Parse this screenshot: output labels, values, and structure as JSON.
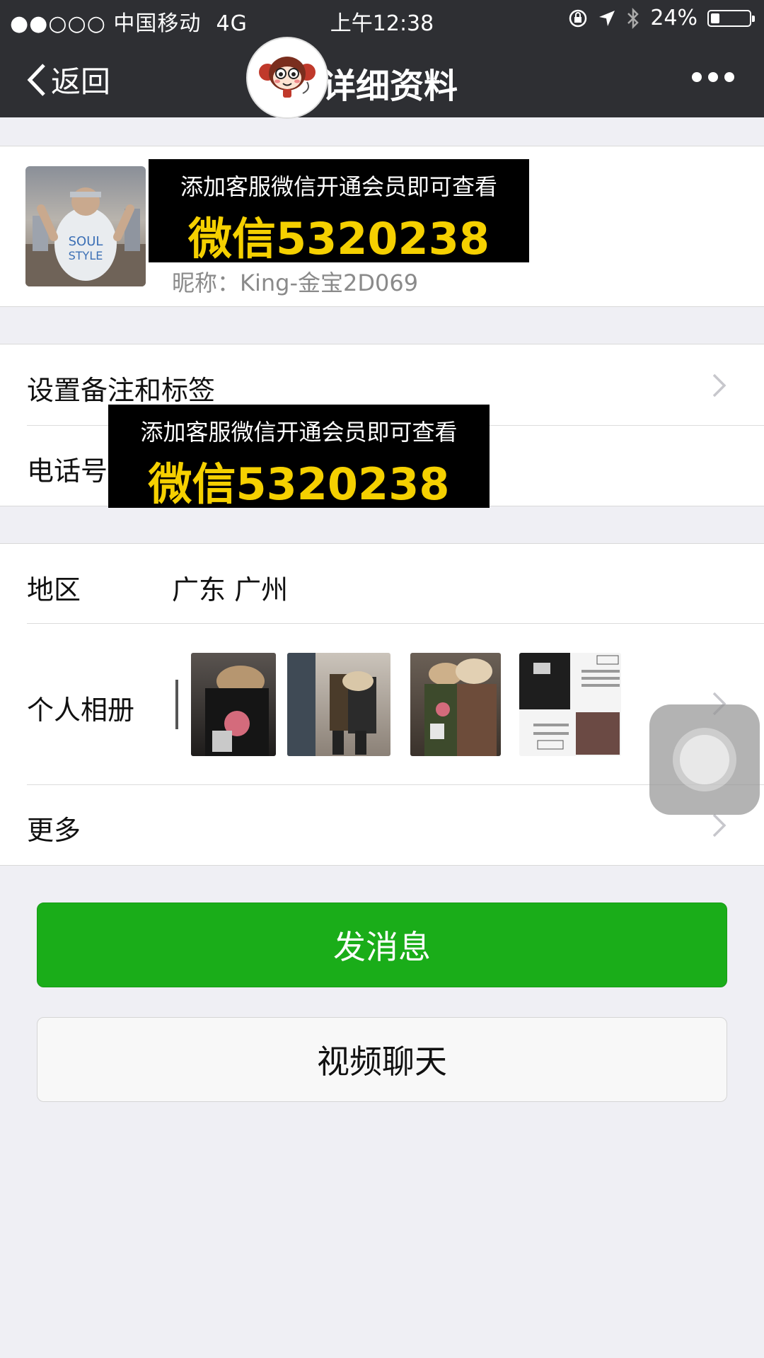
{
  "status_bar": {
    "carrier": "●●○○○ 中国移动",
    "network": "4G",
    "time": "上午12:38",
    "battery": "24%"
  },
  "nav": {
    "back_label": "返回",
    "title": "详细资料"
  },
  "profile": {
    "nickname": "昵称：King-金宝2D069"
  },
  "ads": [
    {
      "line1": "添加客服微信开通会员即可查看",
      "line2": "微信5320238"
    },
    {
      "line1": "添加客服微信开通会员即可查看",
      "line2": "微信5320238"
    }
  ],
  "rows": {
    "remark_label": "设置备注和标签",
    "phone_label": "电话号",
    "region_label": "地区",
    "region_value": "广东 广州",
    "album_label": "个人相册",
    "more_label": "更多"
  },
  "buttons": {
    "send_message": "发消息",
    "video_chat": "视频聊天"
  },
  "colors": {
    "nav_bg": "#2e2f33",
    "primary_green": "#1aad19",
    "ad_yellow": "#f5d000"
  }
}
